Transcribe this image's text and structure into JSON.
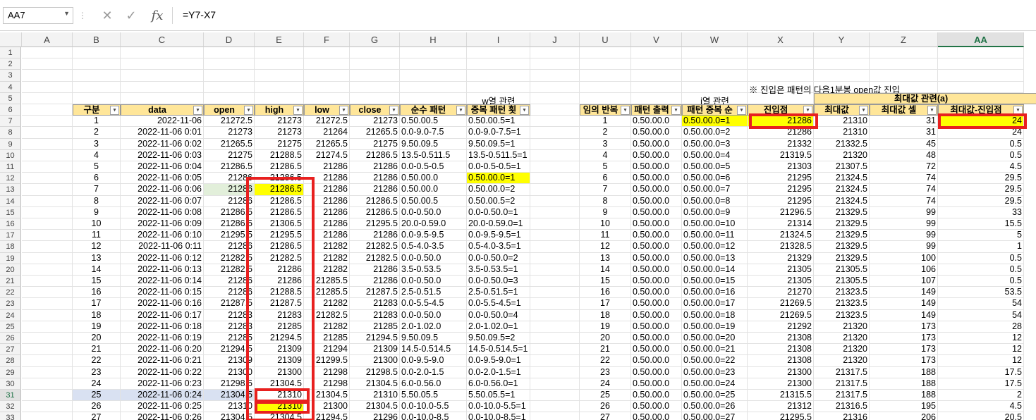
{
  "name_box": "AA7",
  "formula": "=Y7-X7",
  "icons": {
    "cancel": "cancel-icon",
    "enter": "check-icon",
    "fx": "fx-icon",
    "dropdown": "chevron-down-icon"
  },
  "columns": [
    "A",
    "B",
    "C",
    "D",
    "E",
    "F",
    "G",
    "H",
    "I",
    "J",
    "U",
    "V",
    "W",
    "X",
    "Y",
    "Z",
    "AA"
  ],
  "selected_column": "AA",
  "row_numbers": [
    "1",
    "2",
    "3",
    "4",
    "5",
    "6",
    "7",
    "8",
    "9",
    "10",
    "11",
    "12",
    "13",
    "14",
    "15",
    "16",
    "17",
    "18",
    "19",
    "20",
    "21",
    "22",
    "23",
    "24",
    "25",
    "26",
    "27",
    "28",
    "29",
    "30",
    "31",
    "32",
    "33"
  ],
  "selected_row": "31",
  "notes": {
    "w_col": "w열 관련",
    "i_col": "i열 관련",
    "entry_note": "※ 진입은 패턴의 다음1분봉 open값 진입",
    "max_group": "최대값 관련(a)"
  },
  "headers": {
    "B": "구분",
    "C": "data",
    "D": "open",
    "E": "high",
    "F": "low",
    "G": "close",
    "H": "순수 패턴",
    "I": "중복 패턴 횟",
    "U": "임의 반복",
    "V": "패턴 출력",
    "W": "패턴 중복 순",
    "X": "진입점",
    "Y": "최대값",
    "Z": "최대값 셀",
    "AA": "최대값-진입점"
  },
  "rows": [
    {
      "B": "1",
      "C": "2022-11-06",
      "D": "21272.5",
      "E": "21273",
      "F": "21272.5",
      "G": "21273",
      "H": "0.50.00.5",
      "I": "0.50.00.5=1",
      "U": "1",
      "V": "0.50.00.0",
      "W": "0.50.00.0=1",
      "X": "21286",
      "Y": "21310",
      "Z": "31",
      "AA": "24"
    },
    {
      "B": "2",
      "C": "2022-11-06 0:01",
      "D": "21273",
      "E": "21273",
      "F": "21264",
      "G": "21265.5",
      "H": "0.0-9.0-7.5",
      "I": "0.0-9.0-7.5=1",
      "U": "2",
      "V": "0.50.00.0",
      "W": "0.50.00.0=2",
      "X": "21286",
      "Y": "21310",
      "Z": "31",
      "AA": "24"
    },
    {
      "B": "3",
      "C": "2022-11-06 0:02",
      "D": "21265.5",
      "E": "21275",
      "F": "21265.5",
      "G": "21275",
      "H": "9.50.09.5",
      "I": "9.50.09.5=1",
      "U": "3",
      "V": "0.50.00.0",
      "W": "0.50.00.0=3",
      "X": "21332",
      "Y": "21332.5",
      "Z": "45",
      "AA": "0.5"
    },
    {
      "B": "4",
      "C": "2022-11-06 0:03",
      "D": "21275",
      "E": "21288.5",
      "F": "21274.5",
      "G": "21286.5",
      "H": "13.5-0.511.5",
      "I": "13.5-0.511.5=1",
      "U": "4",
      "V": "0.50.00.0",
      "W": "0.50.00.0=4",
      "X": "21319.5",
      "Y": "21320",
      "Z": "48",
      "AA": "0.5"
    },
    {
      "B": "5",
      "C": "2022-11-06 0:04",
      "D": "21286.5",
      "E": "21286.5",
      "F": "21286",
      "G": "21286",
      "H": "0.0-0.5-0.5",
      "I": "0.0-0.5-0.5=1",
      "U": "5",
      "V": "0.50.00.0",
      "W": "0.50.00.0=5",
      "X": "21303",
      "Y": "21307.5",
      "Z": "72",
      "AA": "4.5"
    },
    {
      "B": "6",
      "C": "2022-11-06 0:05",
      "D": "21286",
      "E": "21286.5",
      "F": "21286",
      "G": "21286",
      "H": "0.50.00.0",
      "I": "0.50.00.0=1",
      "U": "6",
      "V": "0.50.00.0",
      "W": "0.50.00.0=6",
      "X": "21295",
      "Y": "21324.5",
      "Z": "74",
      "AA": "29.5"
    },
    {
      "B": "7",
      "C": "2022-11-06 0:06",
      "D": "21286",
      "E": "21286.5",
      "F": "21286",
      "G": "21286",
      "H": "0.50.00.0",
      "I": "0.50.00.0=2",
      "U": "7",
      "V": "0.50.00.0",
      "W": "0.50.00.0=7",
      "X": "21295",
      "Y": "21324.5",
      "Z": "74",
      "AA": "29.5"
    },
    {
      "B": "8",
      "C": "2022-11-06 0:07",
      "D": "21286",
      "E": "21286.5",
      "F": "21286",
      "G": "21286.5",
      "H": "0.50.00.5",
      "I": "0.50.00.5=2",
      "U": "8",
      "V": "0.50.00.0",
      "W": "0.50.00.0=8",
      "X": "21295",
      "Y": "21324.5",
      "Z": "74",
      "AA": "29.5"
    },
    {
      "B": "9",
      "C": "2022-11-06 0:08",
      "D": "21286.5",
      "E": "21286.5",
      "F": "21286",
      "G": "21286.5",
      "H": "0.0-0.50.0",
      "I": "0.0-0.50.0=1",
      "U": "9",
      "V": "0.50.00.0",
      "W": "0.50.00.0=9",
      "X": "21296.5",
      "Y": "21329.5",
      "Z": "99",
      "AA": "33"
    },
    {
      "B": "10",
      "C": "2022-11-06 0:09",
      "D": "21286.5",
      "E": "21306.5",
      "F": "21286",
      "G": "21295.5",
      "H": "20.0-0.59.0",
      "I": "20.0-0.59.0=1",
      "U": "10",
      "V": "0.50.00.0",
      "W": "0.50.00.0=10",
      "X": "21314",
      "Y": "21329.5",
      "Z": "99",
      "AA": "15.5"
    },
    {
      "B": "11",
      "C": "2022-11-06 0:10",
      "D": "21295.5",
      "E": "21295.5",
      "F": "21286",
      "G": "21286",
      "H": "0.0-9.5-9.5",
      "I": "0.0-9.5-9.5=1",
      "U": "11",
      "V": "0.50.00.0",
      "W": "0.50.00.0=11",
      "X": "21324.5",
      "Y": "21329.5",
      "Z": "99",
      "AA": "5"
    },
    {
      "B": "12",
      "C": "2022-11-06 0:11",
      "D": "21286",
      "E": "21286.5",
      "F": "21282",
      "G": "21282.5",
      "H": "0.5-4.0-3.5",
      "I": "0.5-4.0-3.5=1",
      "U": "12",
      "V": "0.50.00.0",
      "W": "0.50.00.0=12",
      "X": "21328.5",
      "Y": "21329.5",
      "Z": "99",
      "AA": "1"
    },
    {
      "B": "13",
      "C": "2022-11-06 0:12",
      "D": "21282.5",
      "E": "21282.5",
      "F": "21282",
      "G": "21282.5",
      "H": "0.0-0.50.0",
      "I": "0.0-0.50.0=2",
      "U": "13",
      "V": "0.50.00.0",
      "W": "0.50.00.0=13",
      "X": "21329",
      "Y": "21329.5",
      "Z": "100",
      "AA": "0.5"
    },
    {
      "B": "14",
      "C": "2022-11-06 0:13",
      "D": "21282.5",
      "E": "21286",
      "F": "21282",
      "G": "21286",
      "H": "3.5-0.53.5",
      "I": "3.5-0.53.5=1",
      "U": "14",
      "V": "0.50.00.0",
      "W": "0.50.00.0=14",
      "X": "21305",
      "Y": "21305.5",
      "Z": "106",
      "AA": "0.5"
    },
    {
      "B": "15",
      "C": "2022-11-06 0:14",
      "D": "21286",
      "E": "21286",
      "F": "21285.5",
      "G": "21286",
      "H": "0.0-0.50.0",
      "I": "0.0-0.50.0=3",
      "U": "15",
      "V": "0.50.00.0",
      "W": "0.50.00.0=15",
      "X": "21305",
      "Y": "21305.5",
      "Z": "107",
      "AA": "0.5"
    },
    {
      "B": "16",
      "C": "2022-11-06 0:15",
      "D": "21286",
      "E": "21288.5",
      "F": "21285.5",
      "G": "21287.5",
      "H": "2.5-0.51.5",
      "I": "2.5-0.51.5=1",
      "U": "16",
      "V": "0.50.00.0",
      "W": "0.50.00.0=16",
      "X": "21270",
      "Y": "21323.5",
      "Z": "149",
      "AA": "53.5"
    },
    {
      "B": "17",
      "C": "2022-11-06 0:16",
      "D": "21287.5",
      "E": "21287.5",
      "F": "21282",
      "G": "21283",
      "H": "0.0-5.5-4.5",
      "I": "0.0-5.5-4.5=1",
      "U": "17",
      "V": "0.50.00.0",
      "W": "0.50.00.0=17",
      "X": "21269.5",
      "Y": "21323.5",
      "Z": "149",
      "AA": "54"
    },
    {
      "B": "18",
      "C": "2022-11-06 0:17",
      "D": "21283",
      "E": "21283",
      "F": "21282.5",
      "G": "21283",
      "H": "0.0-0.50.0",
      "I": "0.0-0.50.0=4",
      "U": "18",
      "V": "0.50.00.0",
      "W": "0.50.00.0=18",
      "X": "21269.5",
      "Y": "21323.5",
      "Z": "149",
      "AA": "54"
    },
    {
      "B": "19",
      "C": "2022-11-06 0:18",
      "D": "21283",
      "E": "21285",
      "F": "21282",
      "G": "21285",
      "H": "2.0-1.02.0",
      "I": "2.0-1.02.0=1",
      "U": "19",
      "V": "0.50.00.0",
      "W": "0.50.00.0=19",
      "X": "21292",
      "Y": "21320",
      "Z": "173",
      "AA": "28"
    },
    {
      "B": "20",
      "C": "2022-11-06 0:19",
      "D": "21285",
      "E": "21294.5",
      "F": "21285",
      "G": "21294.5",
      "H": "9.50.09.5",
      "I": "9.50.09.5=2",
      "U": "20",
      "V": "0.50.00.0",
      "W": "0.50.00.0=20",
      "X": "21308",
      "Y": "21320",
      "Z": "173",
      "AA": "12"
    },
    {
      "B": "21",
      "C": "2022-11-06 0:20",
      "D": "21294.5",
      "E": "21309",
      "F": "21294",
      "G": "21309",
      "H": "14.5-0.514.5",
      "I": "14.5-0.514.5=1",
      "U": "21",
      "V": "0.50.00.0",
      "W": "0.50.00.0=21",
      "X": "21308",
      "Y": "21320",
      "Z": "173",
      "AA": "12"
    },
    {
      "B": "22",
      "C": "2022-11-06 0:21",
      "D": "21309",
      "E": "21309",
      "F": "21299.5",
      "G": "21300",
      "H": "0.0-9.5-9.0",
      "I": "0.0-9.5-9.0=1",
      "U": "22",
      "V": "0.50.00.0",
      "W": "0.50.00.0=22",
      "X": "21308",
      "Y": "21320",
      "Z": "173",
      "AA": "12"
    },
    {
      "B": "23",
      "C": "2022-11-06 0:22",
      "D": "21300",
      "E": "21300",
      "F": "21298",
      "G": "21298.5",
      "H": "0.0-2.0-1.5",
      "I": "0.0-2.0-1.5=1",
      "U": "23",
      "V": "0.50.00.0",
      "W": "0.50.00.0=23",
      "X": "21300",
      "Y": "21317.5",
      "Z": "188",
      "AA": "17.5"
    },
    {
      "B": "24",
      "C": "2022-11-06 0:23",
      "D": "21298.5",
      "E": "21304.5",
      "F": "21298",
      "G": "21304.5",
      "H": "6.0-0.56.0",
      "I": "6.0-0.56.0=1",
      "U": "24",
      "V": "0.50.00.0",
      "W": "0.50.00.0=24",
      "X": "21300",
      "Y": "21317.5",
      "Z": "188",
      "AA": "17.5"
    },
    {
      "B": "25",
      "C": "2022-11-06 0:24",
      "D": "21304.5",
      "E": "21310",
      "F": "21304.5",
      "G": "21310",
      "H": "5.50.05.5",
      "I": "5.50.05.5=1",
      "U": "25",
      "V": "0.50.00.0",
      "W": "0.50.00.0=25",
      "X": "21315.5",
      "Y": "21317.5",
      "Z": "188",
      "AA": "2"
    },
    {
      "B": "26",
      "C": "2022-11-06 0:25",
      "D": "21310",
      "E": "21310",
      "F": "21300",
      "G": "21304.5",
      "H": "0.0-10.0-5.5",
      "I": "0.0-10.0-5.5=1",
      "U": "26",
      "V": "0.50.00.0",
      "W": "0.50.00.0=26",
      "X": "21312",
      "Y": "21316.5",
      "Z": "195",
      "AA": "4.5"
    },
    {
      "B": "27",
      "C": "2022-11-06 0:26",
      "D": "21304.5",
      "E": "21304.5",
      "F": "21294.5",
      "G": "21296",
      "H": "0.0-10.0-8.5",
      "I": "0.0-10.0-8.5=1",
      "U": "27",
      "V": "0.50.00.0",
      "W": "0.50.00.0=27",
      "X": "21295.5",
      "Y": "21316",
      "Z": "206",
      "AA": "20.5"
    }
  ]
}
